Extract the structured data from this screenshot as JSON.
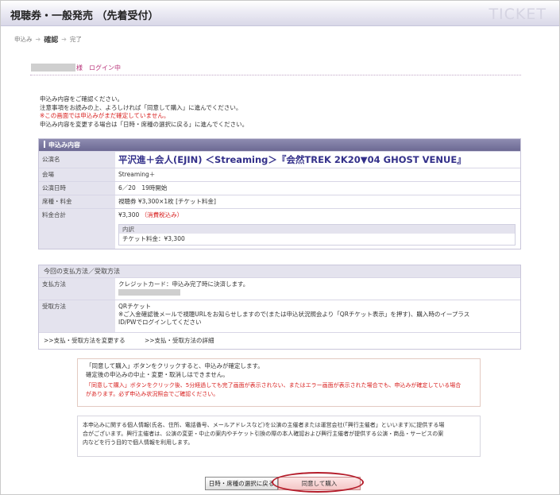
{
  "header": {
    "title": "視聴券・一般発売 （先着受付）",
    "watermark": "TICKET"
  },
  "steps": {
    "step1": "申込み",
    "step2": "確認",
    "step3": "完了",
    "arrow": "➔"
  },
  "login": {
    "status": "様　ログイン中"
  },
  "intro": {
    "line1": "申込み内容をご確認ください。",
    "line2": "注意事項をお読みの上、よろしければ「同意して購入」に進んでください。",
    "line3_red": "※この画面では申込みがまだ確定していません。",
    "line4": "申込み内容を変更する場合は「日時・席種の選択に戻る」に進んでください。"
  },
  "order": {
    "heading": "申込み内容",
    "rows": {
      "performance_label": "公演名",
      "performance_value": "平沢進＋会人(EJIN) ＜Streaming＞『会然TREK 2K20▼04 GHOST VENUE』",
      "venue_label": "会場",
      "venue_value": "Streaming＋",
      "date_label": "公演日時",
      "date_value": "6／20　19時開始",
      "seat_label": "席種・料金",
      "seat_value": "視聴券 ¥3,300×1枚 [チケット料金]",
      "total_label": "料金合計",
      "total_value": "¥3,300",
      "total_tax": "（消費税込み）",
      "breakdown_label": "内訳",
      "breakdown_value": "チケット料金：¥3,300"
    }
  },
  "payment": {
    "heading": "今回の支払方法／受取方法",
    "pay_label": "支払方法",
    "pay_value": "クレジットカード：申込み完了時に決済します。",
    "recv_label": "受取方法",
    "recv_value1": "QRチケット",
    "recv_value2": "※ご入金確認後メールで視聴URLをお知らせしますので(または申込状況照会より「QRチケット表示」を押す)、購入時のイープラス",
    "recv_value3": "ID/PWでログインしてください",
    "link_change": ">>支払・受取方法を変更する",
    "link_detail": ">>支払・受取方法の詳細"
  },
  "notice1": {
    "line1": "「同意して購入」ボタンをクリックすると、申込みが確定します。",
    "line2": "確定後の申込みの中止・変更・取消しはできません。",
    "red1": "「同意して購入」ボタンをクリック後、5分経過しても完了画面が表示されない、またはエラー画面が表示された場合でも、申込みが確定している場合",
    "red2": "があります。必ず申込み状況照会でご確認ください。"
  },
  "notice2": {
    "line1": "本申込みに関する個人情報(氏名、住所、電話番号、メールアドレスなど)を公演の主催者または運営会社(「興行主催者」といいます)に提供する場",
    "line2": "合がございます。興行主催者は、公演の変更・中止の案内やチケット引換の際の本人確認および興行主催者が提供する公演・商品・サービスの案",
    "line3": "内などを行う目的で個人情報を利用します。"
  },
  "buttons": {
    "back": "日時・席種の選択に戻る",
    "agree": "同意して購入"
  }
}
